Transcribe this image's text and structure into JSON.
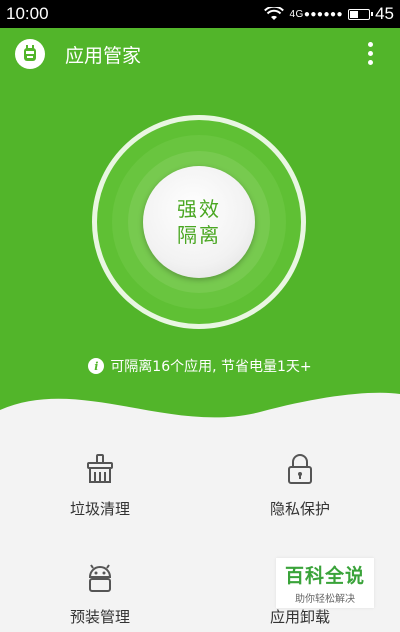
{
  "status_bar": {
    "time": "10:00",
    "network": "4G●●●●●●",
    "battery": "45",
    "battery_level": 0.45
  },
  "app_bar": {
    "title": "应用管家",
    "logo_icon": "robot-icon",
    "menu_icon": "more-vertical-icon"
  },
  "main": {
    "button_line1": "强效",
    "button_line2": "隔离",
    "info_text": "可隔离16个应用, 节省电量1天+",
    "info_icon": "info-icon"
  },
  "tools": [
    {
      "label": "垃圾清理",
      "icon": "broom-icon"
    },
    {
      "label": "隐私保护",
      "icon": "lock-icon"
    },
    {
      "label": "预装管理",
      "icon": "android-icon"
    },
    {
      "label": "应用卸载",
      "icon": "uninstall-icon"
    }
  ],
  "watermark": {
    "title": "百科全说",
    "subtitle": "助你轻松解决"
  },
  "colors": {
    "primary_green": "#52b52a",
    "background": "#f3f3f3"
  }
}
